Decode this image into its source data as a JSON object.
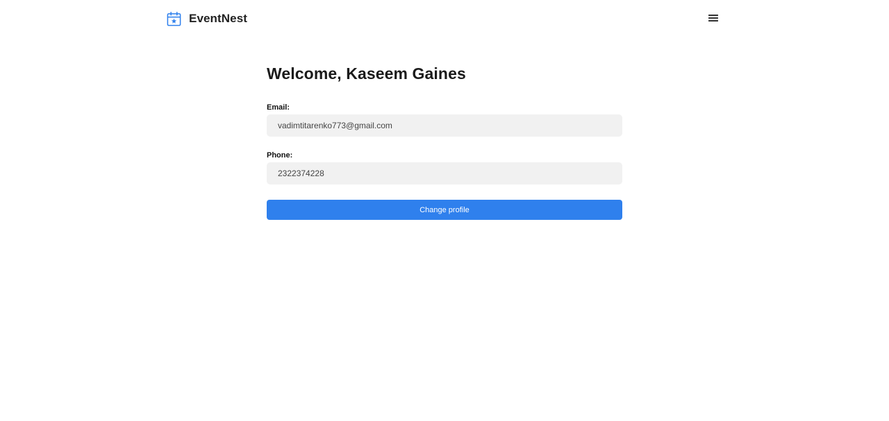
{
  "header": {
    "brand_name": "EventNest",
    "brand_icon": "calendar-star-icon",
    "menu_icon": "hamburger-menu-icon"
  },
  "profile": {
    "title": "Welcome, Kaseem Gaines",
    "email_label": "Email:",
    "email_value": "vadimtitarenko773@gmail.com",
    "phone_label": "Phone:",
    "phone_value": "2322374228",
    "change_button_label": "Change profile"
  },
  "colors": {
    "accent": "#2f80ed",
    "input_background": "#f1f1f1",
    "text": "#1f1f1f"
  }
}
